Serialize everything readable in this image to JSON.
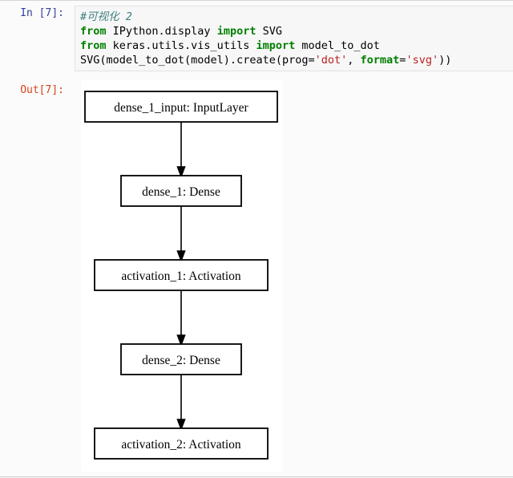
{
  "notebook": {
    "input_prompt": "In [7]:",
    "output_prompt": "Out[7]:",
    "code": {
      "line1": {
        "comment": "#可视化 2"
      },
      "line2": {
        "kw_from": "from",
        "module": " IPython.display ",
        "kw_import": "import",
        "target": " SVG"
      },
      "line3": {
        "kw_from": "from",
        "module": " keras.utils.vis_utils ",
        "kw_import": "import",
        "target": " model_to_dot"
      },
      "line4": {
        "part1": "SVG(model_to_dot(model).create(prog=",
        "str1": "'dot'",
        "part2": ", ",
        "kw_format": "format",
        "eq": "=",
        "str2": "'svg'",
        "part3": "))"
      }
    }
  },
  "graph": {
    "type": "model-architecture-flowchart",
    "direction": "top-to-bottom",
    "nodes": [
      {
        "id": "dense_1_input",
        "label": "dense_1_input: InputLayer"
      },
      {
        "id": "dense_1",
        "label": "dense_1: Dense"
      },
      {
        "id": "activation_1",
        "label": "activation_1: Activation"
      },
      {
        "id": "dense_2",
        "label": "dense_2: Dense"
      },
      {
        "id": "activation_2",
        "label": "activation_2: Activation"
      }
    ],
    "edges": [
      {
        "from": "dense_1_input",
        "to": "dense_1"
      },
      {
        "from": "dense_1",
        "to": "activation_1"
      },
      {
        "from": "activation_1",
        "to": "dense_2"
      },
      {
        "from": "dense_2",
        "to": "activation_2"
      }
    ]
  },
  "colors": {
    "prompt_in": "#303f9f",
    "prompt_out": "#d84315",
    "keyword": "#008000",
    "string": "#ba2121",
    "comment": "#408080",
    "cell_background": "#f7f7f7",
    "output_background": "#ffffff",
    "node_border": "#000000"
  }
}
